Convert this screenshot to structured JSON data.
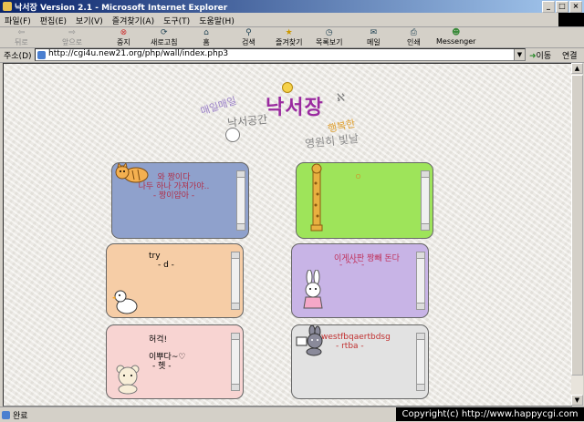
{
  "window": {
    "title": "낙서장 Version 2.1 - Microsoft Internet Explorer",
    "controls": {
      "minimize": "_",
      "maximize": "□",
      "close": "×"
    }
  },
  "menu": [
    "파일(F)",
    "편집(E)",
    "보기(V)",
    "즐겨찾기(A)",
    "도구(T)",
    "도움말(H)"
  ],
  "toolbar": {
    "back": "뒤로",
    "forward": "앞으로",
    "stop": "중지",
    "refresh": "새로고침",
    "home": "홈",
    "search": "검색",
    "favorites": "즐겨찾기",
    "history": "목록보기",
    "mail": "메일",
    "print": "인쇄",
    "messenger": "Messenger"
  },
  "address": {
    "label": "주소(D)",
    "url": "http://cgi4u.new21.org/php/wall/index.php3",
    "go": "이동",
    "links": "연결"
  },
  "status": {
    "text": "완료"
  },
  "copyright": "Copyright(c) http://www.happycgi.com",
  "page": {
    "title": "낙서장",
    "doodles": [
      "매일매일",
      "낙서공간",
      "행복한",
      "영원히 빛날"
    ]
  },
  "notes": [
    {
      "lines": [
        "와 짱이다",
        "나두 하나 가져가야..",
        "- 짱이얍아 -"
      ],
      "color": "#8fa1cc",
      "text_color": "#b0304a",
      "character": "cat-icon"
    },
    {
      "lines": [
        "ㅇ"
      ],
      "color": "#9ee45a",
      "text_color": "#c8a030",
      "character": "giraffe-icon"
    },
    {
      "lines": [
        "try",
        "- d -"
      ],
      "color": "#f6cda6",
      "text_color": "#000000",
      "character": "duck-icon"
    },
    {
      "lines": [
        "이게사판 짱빼 돈다",
        "- ^^ -"
      ],
      "color": "#c8b4e6",
      "text_color": "#c0305a",
      "character": "bunny-icon"
    },
    {
      "lines": [
        "허걱!",
        "이뿌다~♡",
        "- 헷 -"
      ],
      "color": "#f8d4d2",
      "text_color": "#000000",
      "character": "bear-icon"
    },
    {
      "lines": [
        "westfbqaertbdsg",
        "- rtba -"
      ],
      "color": "#e2e2e2",
      "text_color": "#c03030",
      "character": "rabbit-icon"
    }
  ]
}
